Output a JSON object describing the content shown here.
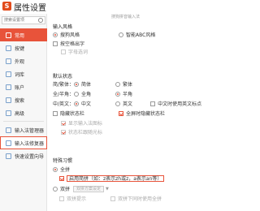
{
  "window": {
    "title": "属性设置",
    "logo_text": "S"
  },
  "search": {
    "placeholder": "搜索设置项"
  },
  "sidebar": {
    "items": [
      {
        "label": "常用",
        "icon": "gear-icon"
      },
      {
        "label": "按键",
        "icon": "keyboard-icon"
      },
      {
        "label": "外观",
        "icon": "skin-icon"
      },
      {
        "label": "词库",
        "icon": "dictionary-icon"
      },
      {
        "label": "账户",
        "icon": "user-icon"
      },
      {
        "label": "搜索",
        "icon": "search-icon"
      },
      {
        "label": "高级",
        "icon": "advanced-icon"
      },
      {
        "label": "输入法管理器",
        "icon": "manager-icon"
      },
      {
        "label": "输入法修复器",
        "icon": "repair-icon"
      },
      {
        "label": "快速设置向导",
        "icon": "wizard-icon"
      }
    ]
  },
  "main": {
    "ghost_text": "搜狗拼音输入法",
    "input_style": {
      "title": "输入风格",
      "opt1": "搜狗风格",
      "opt2": "智能ABC风格",
      "cb1": "按空格出字",
      "cb2": "字母选词"
    },
    "default_state": {
      "title": "默认状态",
      "row1": {
        "label": "简/繁体：",
        "opt1": "简体",
        "opt2": "繁体"
      },
      "row2": {
        "label": "全/半角：",
        "opt1": "全角",
        "opt2": "半角"
      },
      "row3": {
        "label": "中/英文：",
        "opt1": "中文",
        "opt2": "英文",
        "extra": "中文时使用英文标点"
      },
      "cb_hide": "隐藏状态栏",
      "cb_fullscreen": "全屏时隐藏状态栏",
      "sub1": "显示输入法图标",
      "sub2": "状态栏跟随光标"
    },
    "special": {
      "title": "特殊习惯",
      "opt_quanpin": "全拼",
      "cb_fuzzy": "启用简拼（如：z表示zh或z，a表示an等）",
      "opt_shuangpin": "双拼",
      "btn_shuangpin": "双拼方案设定",
      "cb_hint": "双拼提示",
      "cb_show": "双拼下同时使用全拼"
    }
  }
}
